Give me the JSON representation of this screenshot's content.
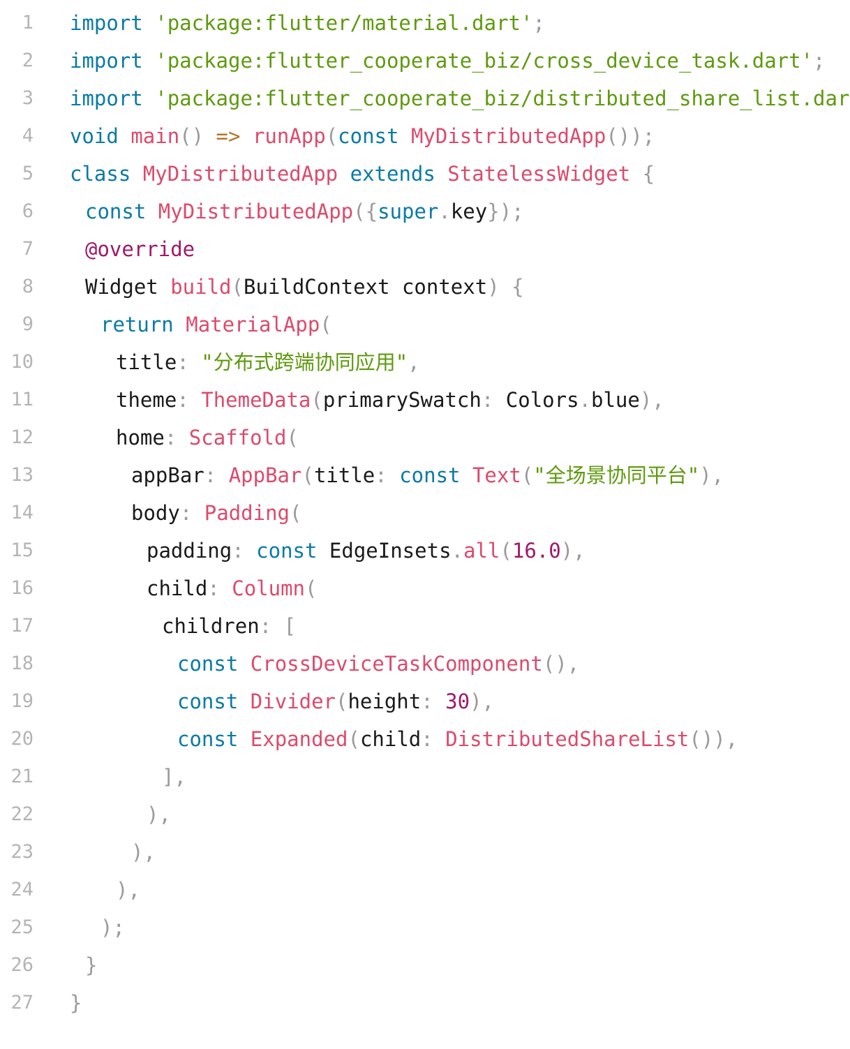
{
  "colors": {
    "background": "#ffffff",
    "line_number": "#b4b4b4",
    "keyword": "#0a7aa6",
    "string": "#5e9a0e",
    "function": "#dc4a6c",
    "number": "#a0186a",
    "annotation": "#a0186a",
    "punctuation": "#9a9a9a",
    "operator": "#b5762d",
    "plain": "#1a1a1a"
  },
  "lines": [
    {
      "n": "1",
      "indent": 0,
      "tokens": [
        [
          "kw",
          "import"
        ],
        [
          "plain",
          " "
        ],
        [
          "str",
          "'package:flutter/material.dart'"
        ],
        [
          "pun",
          ";"
        ]
      ]
    },
    {
      "n": "2",
      "indent": 0,
      "tokens": [
        [
          "kw",
          "import"
        ],
        [
          "plain",
          " "
        ],
        [
          "str",
          "'package:flutter_cooperate_biz/cross_device_task.dart'"
        ],
        [
          "pun",
          ";"
        ]
      ]
    },
    {
      "n": "3",
      "indent": 0,
      "tokens": [
        [
          "kw",
          "import"
        ],
        [
          "plain",
          " "
        ],
        [
          "str",
          "'package:flutter_cooperate_biz/distributed_share_list.dart'"
        ],
        [
          "pun",
          ";"
        ]
      ]
    },
    {
      "n": "4",
      "indent": 0,
      "tokens": [
        [
          "kw",
          "void"
        ],
        [
          "plain",
          " "
        ],
        [
          "fn",
          "main"
        ],
        [
          "pun",
          "()"
        ],
        [
          "plain",
          " "
        ],
        [
          "opr",
          "=>"
        ],
        [
          "plain",
          " "
        ],
        [
          "fn",
          "runApp"
        ],
        [
          "pun",
          "("
        ],
        [
          "kw",
          "const"
        ],
        [
          "plain",
          " "
        ],
        [
          "fn",
          "MyDistributedApp"
        ],
        [
          "pun",
          "());"
        ]
      ]
    },
    {
      "n": "5",
      "indent": 0,
      "tokens": [
        [
          "kw",
          "class"
        ],
        [
          "plain",
          " "
        ],
        [
          "fn",
          "MyDistributedApp"
        ],
        [
          "plain",
          " "
        ],
        [
          "kw",
          "extends"
        ],
        [
          "plain",
          " "
        ],
        [
          "fn",
          "StatelessWidget"
        ],
        [
          "plain",
          " "
        ],
        [
          "pun",
          "{"
        ]
      ]
    },
    {
      "n": "6",
      "indent": 1,
      "tokens": [
        [
          "kw",
          "const"
        ],
        [
          "plain",
          " "
        ],
        [
          "fn",
          "MyDistributedApp"
        ],
        [
          "pun",
          "({"
        ],
        [
          "kw",
          "super"
        ],
        [
          "pun",
          "."
        ],
        [
          "plain",
          "key"
        ],
        [
          "pun",
          "});"
        ]
      ]
    },
    {
      "n": "7",
      "indent": 1,
      "tokens": [
        [
          "ann",
          "@override"
        ]
      ]
    },
    {
      "n": "8",
      "indent": 1,
      "tokens": [
        [
          "plain",
          "Widget "
        ],
        [
          "fn",
          "build"
        ],
        [
          "pun",
          "("
        ],
        [
          "plain",
          "BuildContext context"
        ],
        [
          "pun",
          ")"
        ],
        [
          "plain",
          " "
        ],
        [
          "pun",
          "{"
        ]
      ]
    },
    {
      "n": "9",
      "indent": 2,
      "tokens": [
        [
          "kw",
          "return"
        ],
        [
          "plain",
          " "
        ],
        [
          "fn",
          "MaterialApp"
        ],
        [
          "pun",
          "("
        ]
      ]
    },
    {
      "n": "10",
      "indent": 3,
      "tokens": [
        [
          "plain",
          "title"
        ],
        [
          "pun",
          ":"
        ],
        [
          "plain",
          " "
        ],
        [
          "str",
          "\"分布式跨端协同应用\""
        ],
        [
          "pun",
          ","
        ]
      ]
    },
    {
      "n": "11",
      "indent": 3,
      "tokens": [
        [
          "plain",
          "theme"
        ],
        [
          "pun",
          ":"
        ],
        [
          "plain",
          " "
        ],
        [
          "fn",
          "ThemeData"
        ],
        [
          "pun",
          "("
        ],
        [
          "plain",
          "primarySwatch"
        ],
        [
          "pun",
          ":"
        ],
        [
          "plain",
          " Colors"
        ],
        [
          "pun",
          "."
        ],
        [
          "plain",
          "blue"
        ],
        [
          "pun",
          "),"
        ]
      ]
    },
    {
      "n": "12",
      "indent": 3,
      "tokens": [
        [
          "plain",
          "home"
        ],
        [
          "pun",
          ":"
        ],
        [
          "plain",
          " "
        ],
        [
          "fn",
          "Scaffold"
        ],
        [
          "pun",
          "("
        ]
      ]
    },
    {
      "n": "13",
      "indent": 4,
      "tokens": [
        [
          "plain",
          "appBar"
        ],
        [
          "pun",
          ":"
        ],
        [
          "plain",
          " "
        ],
        [
          "fn",
          "AppBar"
        ],
        [
          "pun",
          "("
        ],
        [
          "plain",
          "title"
        ],
        [
          "pun",
          ":"
        ],
        [
          "plain",
          " "
        ],
        [
          "kw",
          "const"
        ],
        [
          "plain",
          " "
        ],
        [
          "fn",
          "Text"
        ],
        [
          "pun",
          "("
        ],
        [
          "str",
          "\"全场景协同平台\""
        ],
        [
          "pun",
          "),"
        ]
      ]
    },
    {
      "n": "14",
      "indent": 4,
      "tokens": [
        [
          "plain",
          "body"
        ],
        [
          "pun",
          ":"
        ],
        [
          "plain",
          " "
        ],
        [
          "fn",
          "Padding"
        ],
        [
          "pun",
          "("
        ]
      ]
    },
    {
      "n": "15",
      "indent": 5,
      "tokens": [
        [
          "plain",
          "padding"
        ],
        [
          "pun",
          ":"
        ],
        [
          "plain",
          " "
        ],
        [
          "kw",
          "const"
        ],
        [
          "plain",
          " EdgeInsets"
        ],
        [
          "pun",
          "."
        ],
        [
          "fn",
          "all"
        ],
        [
          "pun",
          "("
        ],
        [
          "num",
          "16.0"
        ],
        [
          "pun",
          "),"
        ]
      ]
    },
    {
      "n": "16",
      "indent": 5,
      "tokens": [
        [
          "plain",
          "child"
        ],
        [
          "pun",
          ":"
        ],
        [
          "plain",
          " "
        ],
        [
          "fn",
          "Column"
        ],
        [
          "pun",
          "("
        ]
      ]
    },
    {
      "n": "17",
      "indent": 6,
      "tokens": [
        [
          "plain",
          "children"
        ],
        [
          "pun",
          ":"
        ],
        [
          "plain",
          " "
        ],
        [
          "pun",
          "["
        ]
      ]
    },
    {
      "n": "18",
      "indent": 7,
      "tokens": [
        [
          "kw",
          "const"
        ],
        [
          "plain",
          " "
        ],
        [
          "fn",
          "CrossDeviceTaskComponent"
        ],
        [
          "pun",
          "(),"
        ]
      ]
    },
    {
      "n": "19",
      "indent": 7,
      "tokens": [
        [
          "kw",
          "const"
        ],
        [
          "plain",
          " "
        ],
        [
          "fn",
          "Divider"
        ],
        [
          "pun",
          "("
        ],
        [
          "plain",
          "height"
        ],
        [
          "pun",
          ":"
        ],
        [
          "plain",
          " "
        ],
        [
          "num",
          "30"
        ],
        [
          "pun",
          "),"
        ]
      ]
    },
    {
      "n": "20",
      "indent": 7,
      "tokens": [
        [
          "kw",
          "const"
        ],
        [
          "plain",
          " "
        ],
        [
          "fn",
          "Expanded"
        ],
        [
          "pun",
          "("
        ],
        [
          "plain",
          "child"
        ],
        [
          "pun",
          ":"
        ],
        [
          "plain",
          " "
        ],
        [
          "fn",
          "DistributedShareList"
        ],
        [
          "pun",
          "()),"
        ]
      ]
    },
    {
      "n": "21",
      "indent": 6,
      "tokens": [
        [
          "pun",
          "],"
        ]
      ]
    },
    {
      "n": "22",
      "indent": 5,
      "tokens": [
        [
          "pun",
          "),"
        ]
      ]
    },
    {
      "n": "23",
      "indent": 4,
      "tokens": [
        [
          "pun",
          "),"
        ]
      ]
    },
    {
      "n": "24",
      "indent": 3,
      "tokens": [
        [
          "pun",
          "),"
        ]
      ]
    },
    {
      "n": "25",
      "indent": 2,
      "tokens": [
        [
          "pun",
          ");"
        ]
      ]
    },
    {
      "n": "26",
      "indent": 1,
      "tokens": [
        [
          "pun",
          "}"
        ]
      ]
    },
    {
      "n": "27",
      "indent": 0,
      "tokens": [
        [
          "pun",
          "}"
        ]
      ]
    }
  ]
}
